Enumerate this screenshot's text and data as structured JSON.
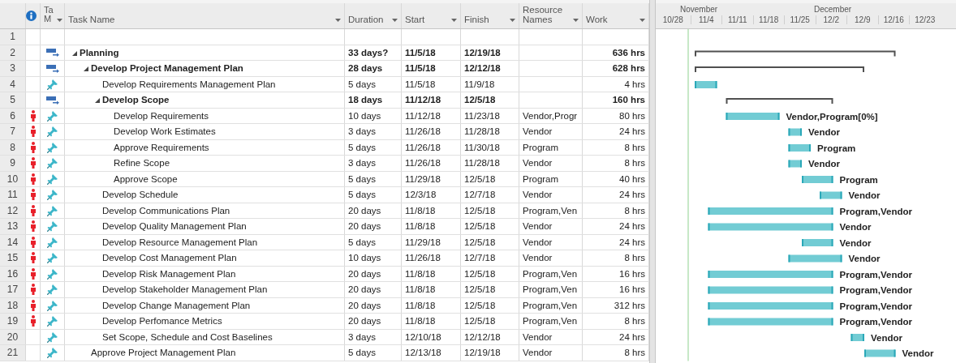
{
  "columns": [
    {
      "label": "Ta M"
    },
    {
      "label": "Task Name"
    },
    {
      "label": "Duration"
    },
    {
      "label": "Start"
    },
    {
      "label": "Finish"
    },
    {
      "label": "Resource Names"
    },
    {
      "label": "Work"
    }
  ],
  "timescale": {
    "months": [
      "November",
      "December"
    ],
    "weeks": [
      "10/28",
      "11/4",
      "11/11",
      "11/18",
      "11/25",
      "12/2",
      "12/9",
      "12/16",
      "12/23"
    ]
  },
  "rows": [
    {
      "row_number": "1"
    },
    {
      "row_number": "2",
      "kind": "summary",
      "expanded": true,
      "manually_scheduled": false,
      "overallocated": false,
      "name": "Planning",
      "duration": "33 days?",
      "start": "11/5/18",
      "finish": "12/19/18",
      "work": "636 hrs",
      "children": [
        {
          "row_number": "3",
          "kind": "summary",
          "expanded": true,
          "manually_scheduled": false,
          "overallocated": false,
          "name": "Develop Project Management Plan",
          "duration": "28 days",
          "start": "11/5/18",
          "finish": "12/12/18",
          "work": "628 hrs",
          "children": [
            {
              "row_number": "4",
              "kind": "task",
              "manually_scheduled": true,
              "overallocated": false,
              "name": "Develop Requirements Management Plan",
              "duration": "5 days",
              "start": "11/5/18",
              "finish": "11/9/18",
              "work": "4 hrs"
            },
            {
              "row_number": "5",
              "kind": "summary",
              "expanded": true,
              "manually_scheduled": false,
              "overallocated": false,
              "name": "Develop Scope",
              "duration": "18 days",
              "start": "11/12/18",
              "finish": "12/5/18",
              "work": "160 hrs",
              "children": [
                {
                  "row_number": "6",
                  "kind": "task",
                  "manually_scheduled": true,
                  "overallocated": true,
                  "name": "Develop Requirements",
                  "duration": "10 days",
                  "start": "11/12/18",
                  "finish": "11/23/18",
                  "resources": "Vendor,Progr",
                  "work": "80 hrs",
                  "bar_label": "Vendor,Program[0%]"
                },
                {
                  "row_number": "7",
                  "kind": "task",
                  "manually_scheduled": true,
                  "overallocated": true,
                  "name": "Develop Work Estimates",
                  "duration": "3 days",
                  "start": "11/26/18",
                  "finish": "11/28/18",
                  "resources": "Vendor",
                  "work": "24 hrs",
                  "bar_label": "Vendor"
                },
                {
                  "row_number": "8",
                  "kind": "task",
                  "manually_scheduled": true,
                  "overallocated": true,
                  "name": "Approve Requirements",
                  "duration": "5 days",
                  "start": "11/26/18",
                  "finish": "11/30/18",
                  "resources": "Program",
                  "work": "8 hrs",
                  "bar_label": "Program"
                },
                {
                  "row_number": "9",
                  "kind": "task",
                  "manually_scheduled": true,
                  "overallocated": true,
                  "name": "Refine Scope",
                  "duration": "3 days",
                  "start": "11/26/18",
                  "finish": "11/28/18",
                  "resources": "Vendor",
                  "work": "8 hrs",
                  "bar_label": "Vendor"
                },
                {
                  "row_number": "10",
                  "kind": "task",
                  "manually_scheduled": true,
                  "overallocated": true,
                  "name": "Approve Scope",
                  "duration": "5 days",
                  "start": "11/29/18",
                  "finish": "12/5/18",
                  "resources": "Program",
                  "work": "40 hrs",
                  "bar_label": "Program"
                }
              ]
            },
            {
              "row_number": "11",
              "kind": "task",
              "manually_scheduled": true,
              "overallocated": true,
              "name": "Develop Schedule",
              "duration": "5 days",
              "start": "12/3/18",
              "finish": "12/7/18",
              "resources": "Vendor",
              "work": "24 hrs",
              "bar_label": "Vendor"
            },
            {
              "row_number": "12",
              "kind": "task",
              "manually_scheduled": true,
              "overallocated": true,
              "name": "Develop Communications Plan",
              "duration": "20 days",
              "start": "11/8/18",
              "finish": "12/5/18",
              "resources": "Program,Ven",
              "work": "8 hrs",
              "bar_label": "Program,Vendor"
            },
            {
              "row_number": "13",
              "kind": "task",
              "manually_scheduled": true,
              "overallocated": true,
              "name": "Develop Quality Management Plan",
              "duration": "20 days",
              "start": "11/8/18",
              "finish": "12/5/18",
              "resources": "Vendor",
              "work": "24 hrs",
              "bar_label": "Vendor"
            },
            {
              "row_number": "14",
              "kind": "task",
              "manually_scheduled": true,
              "overallocated": true,
              "name": "Develop Resource Management Plan",
              "duration": "5 days",
              "start": "11/29/18",
              "finish": "12/5/18",
              "resources": "Vendor",
              "work": "24 hrs",
              "bar_label": "Vendor"
            },
            {
              "row_number": "15",
              "kind": "task",
              "manually_scheduled": true,
              "overallocated": true,
              "name": "Develop Cost Management Plan",
              "duration": "10 days",
              "start": "11/26/18",
              "finish": "12/7/18",
              "resources": "Vendor",
              "work": "8 hrs",
              "bar_label": "Vendor"
            },
            {
              "row_number": "16",
              "kind": "task",
              "manually_scheduled": true,
              "overallocated": true,
              "name": "Develop Risk Management Plan",
              "duration": "20 days",
              "start": "11/8/18",
              "finish": "12/5/18",
              "resources": "Program,Ven",
              "work": "16 hrs",
              "bar_label": "Program,Vendor"
            },
            {
              "row_number": "17",
              "kind": "task",
              "manually_scheduled": true,
              "overallocated": true,
              "name": "Develop Stakeholder Management Plan",
              "duration": "20 days",
              "start": "11/8/18",
              "finish": "12/5/18",
              "resources": "Program,Ven",
              "work": "16 hrs",
              "bar_label": "Program,Vendor"
            },
            {
              "row_number": "18",
              "kind": "task",
              "manually_scheduled": true,
              "overallocated": true,
              "name": "Develop Change Management Plan",
              "duration": "20 days",
              "start": "11/8/18",
              "finish": "12/5/18",
              "resources": "Program,Ven",
              "work": "312 hrs",
              "bar_label": "Program,Vendor"
            },
            {
              "row_number": "19",
              "kind": "task",
              "manually_scheduled": true,
              "overallocated": true,
              "name": "Develop Perfomance Metrics",
              "duration": "20 days",
              "start": "11/8/18",
              "finish": "12/5/18",
              "resources": "Program,Ven",
              "work": "8 hrs",
              "bar_label": "Program,Vendor"
            },
            {
              "row_number": "20",
              "kind": "task",
              "manually_scheduled": true,
              "overallocated": false,
              "name": "Set Scope, Schedule and Cost Baselines",
              "duration": "3 days",
              "start": "12/10/18",
              "finish": "12/12/18",
              "resources": "Vendor",
              "work": "24 hrs",
              "bar_label": "Vendor"
            }
          ]
        },
        {
          "row_number": "21",
          "kind": "task",
          "manually_scheduled": true,
          "overallocated": false,
          "name": "Approve Project Management Plan",
          "duration": "5 days",
          "start": "12/13/18",
          "finish": "12/19/18",
          "resources": "Vendor",
          "work": "8 hrs",
          "bar_label": "Vendor"
        }
      ]
    }
  ]
}
